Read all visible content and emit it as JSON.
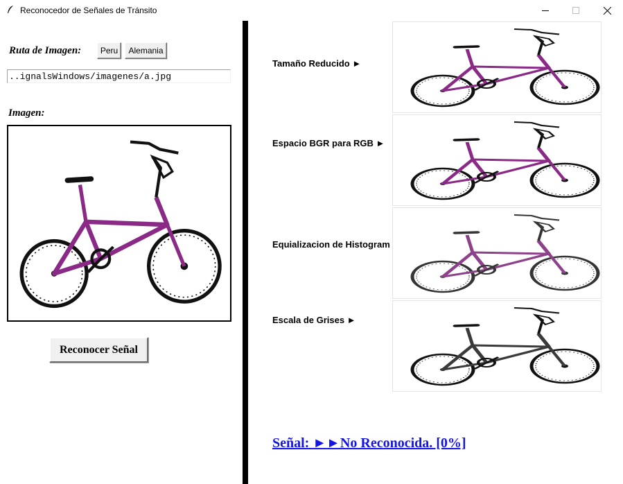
{
  "window": {
    "title": "Reconocedor de Señales de Tránsito",
    "controls": [
      "minimize-icon",
      "maximize-icon",
      "close-icon"
    ]
  },
  "left_panel": {
    "route_label": "Ruta de Imagen:",
    "country_buttons": [
      "Peru",
      "Alemania"
    ],
    "path_value": "..ignalsWindows/imagenes/a.jpg",
    "image_label": "Imagen:",
    "recognize_button": "Reconocer Señal"
  },
  "right_panel": {
    "steps": [
      {
        "label": "Tamaño Reducido ►",
        "mode": "color"
      },
      {
        "label": "Espacio BGR para RGB ►",
        "mode": "color"
      },
      {
        "label": "Equializacion de Histogram",
        "mode": "equalized"
      },
      {
        "label": "Escala de Grises ►",
        "mode": "gray"
      }
    ],
    "result_text": "Señal: ►►No Reconocida. [0%]"
  },
  "colors": {
    "bike_frame": "#8a2a86",
    "result_link": "#1414e6",
    "divider": "#000000",
    "button_face": "#f0f0f0"
  }
}
